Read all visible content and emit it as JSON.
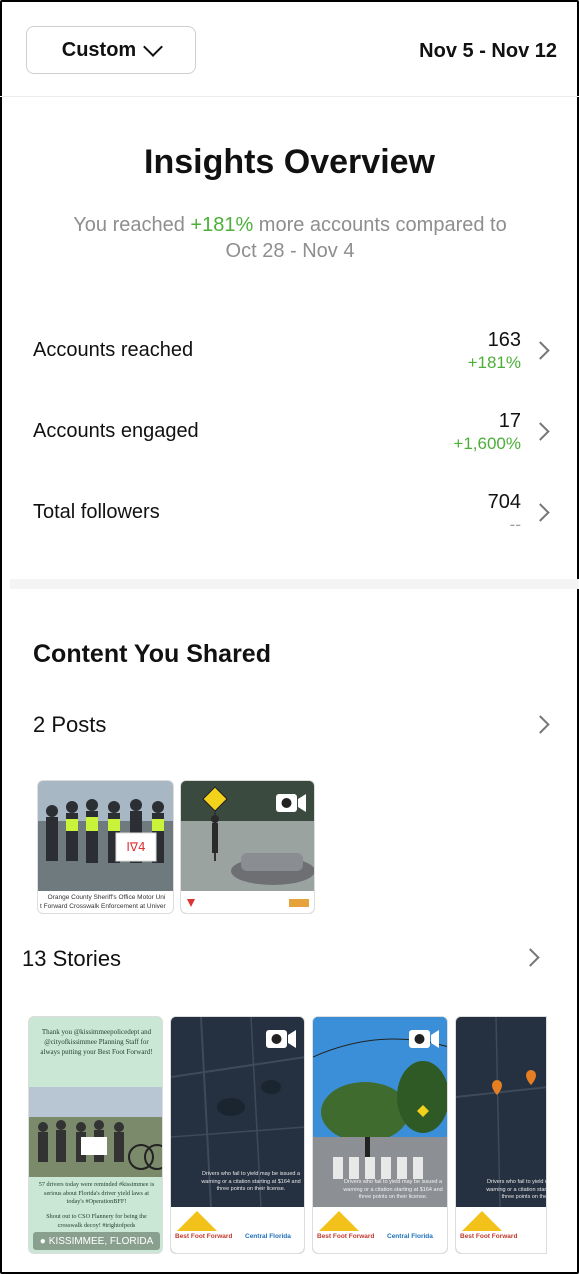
{
  "header": {
    "range_button_label": "Custom",
    "date_range": "Nov 5 - Nov 12"
  },
  "overview": {
    "title": "Insights Overview",
    "subtitle_prefix": "You reached ",
    "subtitle_highlight": "+181%",
    "subtitle_suffix": " more accounts compared to",
    "subtitle_line2": "Oct 28 - Nov 4"
  },
  "metrics": [
    {
      "label": "Accounts reached",
      "value": "163",
      "change": "+181%"
    },
    {
      "label": "Accounts engaged",
      "value": "17",
      "change": "+1,600%"
    },
    {
      "label": "Total followers",
      "value": "704",
      "change": "--"
    }
  ],
  "content": {
    "section_title": "Content You Shared",
    "posts_label": "2 Posts",
    "stories_label": "13 Stories",
    "post_captions": [
      "Orange County Sheriff's Office Motor Uni",
      "t Forward Crosswalk Enforcement at Univer"
    ],
    "story_1_text_top": "Thank you @kissimmeepolicedept and @cityofkissimmee Planning Staff for always putting your Best Foot Forward!",
    "story_1_text_mid": "57 drivers today were reminded #kissimmee is serious about Florida's driver yield laws at today's #OperationBFF!",
    "story_1_text_bottom": "Shout out to CSO Flannery for being the crosswalk decoy! #irightofpeds",
    "story_1_location": "KISSIMMEE, FLORIDA",
    "story_warning_text": "Drivers who fail to yield may be issued a warning or a citation starting at $164 and three points on their license.",
    "logo_bff": "Best Foot Forward",
    "logo_bff_sub": "for pedestrian safety",
    "logo_bikewalk": "BikeWalk",
    "logo_bikewalk_sub": "Central Florida"
  },
  "colors": {
    "positive": "#4caf38",
    "muted": "#8e8e8e",
    "neutral_change": "#9e9e9e"
  }
}
